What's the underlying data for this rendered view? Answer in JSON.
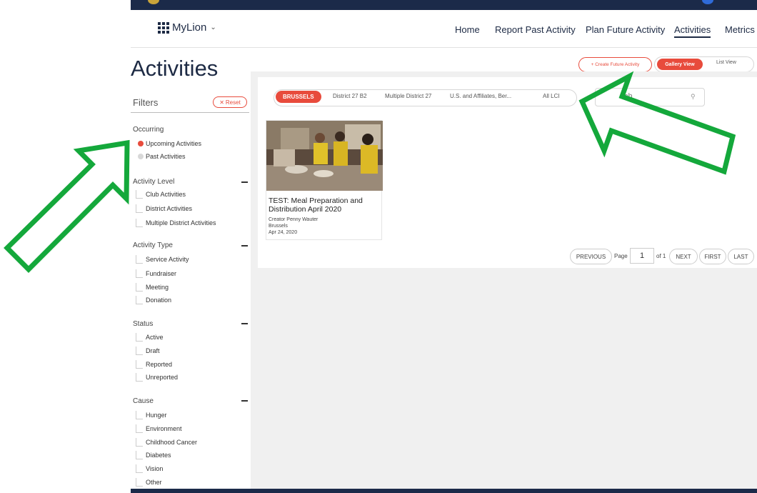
{
  "header": {
    "brand": "MyLion",
    "nav": [
      "Home",
      "Report Past Activity",
      "Plan Future Activity",
      "Activities",
      "Metrics"
    ],
    "active_nav": "Activities"
  },
  "page": {
    "title": "Activities"
  },
  "filters": {
    "heading": "Filters",
    "reset_label": "Reset",
    "occurring": {
      "title": "Occurring",
      "options": [
        "Upcoming Activities",
        "Past Activities"
      ],
      "selected": "Upcoming Activities"
    },
    "activity_level": {
      "title": "Activity Level",
      "options": [
        "Club Activities",
        "District Activities",
        "Multiple District Activities"
      ]
    },
    "activity_type": {
      "title": "Activity Type",
      "options": [
        "Service Activity",
        "Fundraiser",
        "Meeting",
        "Donation"
      ]
    },
    "status": {
      "title": "Status",
      "options": [
        "Active",
        "Draft",
        "Reported",
        "Unreported"
      ]
    },
    "cause": {
      "title": "Cause",
      "options": [
        "Hunger",
        "Environment",
        "Childhood Cancer",
        "Diabetes",
        "Vision",
        "Other"
      ]
    }
  },
  "toolbar": {
    "create_label": "+ Create Future Activity",
    "gallery_label": "Gallery View",
    "list_label": "List View",
    "search_placeholder": "ch"
  },
  "scope_pills": [
    "BRUSSELS",
    "District 27 B2",
    "Multiple District 27",
    "U.S. and Affiliates, Ber...",
    "All LCI"
  ],
  "scope_selected": "BRUSSELS",
  "cards": [
    {
      "title": "TEST: Meal Preparation and Distribution April 2020",
      "creator": "Creator Penny Wauter",
      "club": "Brussels",
      "date": "Apr 24, 2020"
    }
  ],
  "pagination": {
    "previous": "PREVIOUS",
    "page_label": "Page",
    "current_page": "1",
    "of_label": "of 1",
    "next": "NEXT",
    "first": "FIRST",
    "last": "LAST"
  },
  "colors": {
    "accent": "#e84b3c",
    "navy": "#1b2a49",
    "arrow": "#14a83b"
  }
}
